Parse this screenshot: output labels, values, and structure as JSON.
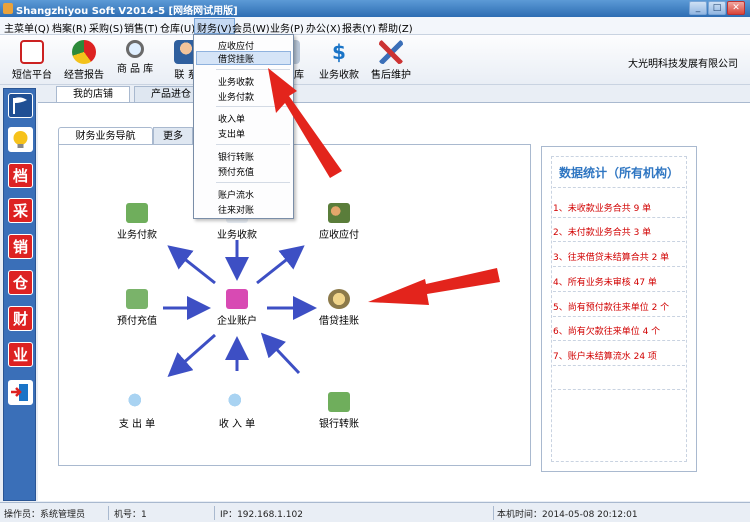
{
  "window": {
    "title": "Shangzhiyou Soft V2014-5 [网络网试用版]",
    "min_label": "_",
    "max_label": "□",
    "close_label": "✕"
  },
  "menu": [
    "主菜单(Q)",
    "档案(R)",
    "采购(S)",
    "销售(T)",
    "仓库(U)",
    "财务(V)",
    "会员(W)",
    "业务(P)",
    "办公(X)",
    "报表(Y)",
    "帮助(Z)"
  ],
  "toolbar": {
    "items": [
      "短信平台",
      "经营报告",
      "商 品 库",
      "联 系",
      "",
      "库",
      "业务收款",
      "售后维护"
    ],
    "company": "大光明科技发展有限公司"
  },
  "leftbar": {
    "glyphs": [
      "",
      "",
      "档",
      "采",
      "销",
      "仓",
      "财",
      "业",
      ""
    ]
  },
  "page_tabs": [
    "我的店铺",
    "产品进仓"
  ],
  "nav_tabs": [
    "财务业务导航",
    "更多"
  ],
  "nav": {
    "nodes": [
      "业务付款",
      "业务收款",
      "应收应付",
      "预付充值",
      "企业账户",
      "借贷挂账",
      "支 出 单",
      "收 入 单",
      "银行转账"
    ]
  },
  "stats": {
    "title": "数据统计（所有机构）",
    "items": [
      "1、未收款业务合共 9 单",
      "2、未付款业务合共 3 单",
      "3、往来借贷未结算合共 2 单",
      "4、所有业务未审核 47 单",
      "5、尚有预付款往来单位 2 个",
      "6、尚有欠款往来单位 4 个",
      "7、账户未结算流水 24 项"
    ]
  },
  "dropdown": {
    "items": [
      "应收应付",
      "借贷挂账",
      "业务收款",
      "业务付款",
      "收入单",
      "支出单",
      "银行转账",
      "预付充值",
      "账户流水",
      "往来对账"
    ]
  },
  "status": {
    "operator": "操作员：系统管理员",
    "machine": "机号：1",
    "ip": "IP：192.168.1.102",
    "time": "本机时间：2014-05-08 20:12:01"
  }
}
